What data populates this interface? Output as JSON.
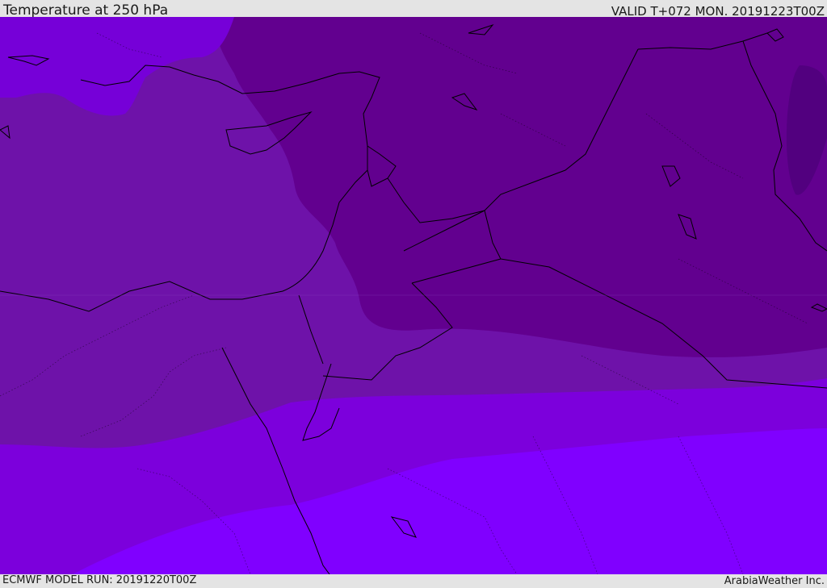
{
  "header": {
    "title": "Temperature at 250 hPa",
    "valid_time": "VALID T+072 MON. 20191223T00Z"
  },
  "footer": {
    "model_run": "ECMWF MODEL RUN: 20191220T00Z",
    "credit": "ArabiaWeather Inc."
  },
  "map": {
    "colors": {
      "band_coldest": "#4f0082",
      "band_cold": "#5c0090",
      "band_mid_dark": "#6a0097",
      "band_mid": "#6e12a9",
      "band_mid_light": "#7c00dc",
      "band_warm": "#8000ff",
      "coastline": "#000000",
      "border": "#000000"
    }
  }
}
